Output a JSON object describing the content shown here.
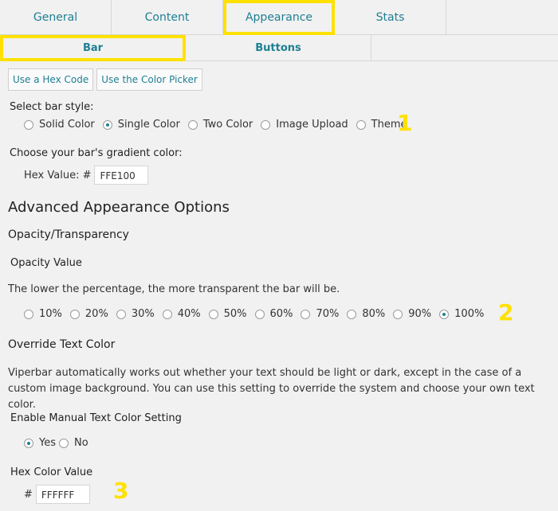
{
  "tabs": [
    {
      "label": "General"
    },
    {
      "label": "Content"
    },
    {
      "label": "Appearance"
    },
    {
      "label": "Stats"
    }
  ],
  "subtabs": [
    {
      "label": "Bar"
    },
    {
      "label": "Buttons"
    }
  ],
  "color_buttons": {
    "hex": "Use a Hex Code",
    "picker": "Use the Color Picker"
  },
  "bar_style": {
    "label": "Select bar style:",
    "options": [
      "Solid Color",
      "Single Color",
      "Two Color",
      "Image Upload",
      "Theme"
    ],
    "selected": "Single Color"
  },
  "gradient": {
    "label": "Choose your bar's gradient color:",
    "field_label": "Hex Value: #",
    "value": "FFE100"
  },
  "advanced": {
    "title": "Advanced Appearance Options",
    "opacity_title": "Opacity/Transparency",
    "opacity_value_label": "Opacity Value",
    "opacity_help": "The lower the percentage, the more transparent the bar will be.",
    "opacity_options": [
      "10%",
      "20%",
      "30%",
      "40%",
      "50%",
      "60%",
      "70%",
      "80%",
      "90%",
      "100%"
    ],
    "opacity_selected": "100%",
    "override_title": "Override Text Color",
    "override_help": "Viperbar automatically works out whether your text should be light or dark, except in the case of a custom image background. You can use this setting to override the system and choose your own text color.",
    "manual_label": "Enable Manual Text Color Setting",
    "manual_yes": "Yes",
    "manual_no": "No",
    "manual_selected": "Yes",
    "hex_label": "Hex Color Value",
    "hex_prefix": "#",
    "hex_value": "FFFFFF"
  },
  "markers": [
    "1",
    "2",
    "3"
  ],
  "colors": {
    "accent": "#1e7f93",
    "highlight": "#ffe100",
    "background": "#f1f1f1"
  }
}
